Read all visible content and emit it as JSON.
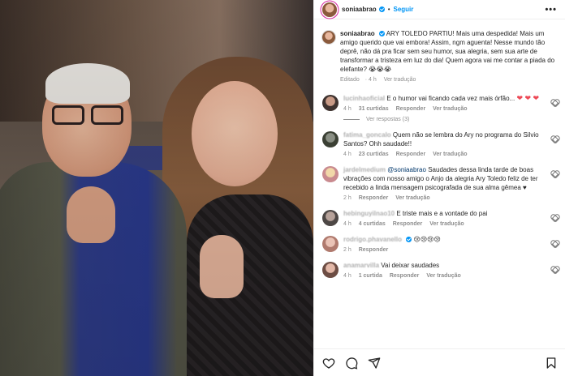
{
  "post": {
    "username": "soniaabrao",
    "follow_label": "Seguir",
    "more_label": "•••",
    "caption": "ARY TOLEDO PARTIU! Mais uma despedida! Mais um amigo querido que vai embora! Assim, ngm aguenta! Nesse mundo tão deprê, não dá pra ficar sem seu humor, sua alegria, sem sua arte de transformar a tristeza em luz do dia! Quem agora vai me contar a piada do elefante? 😭😭😭",
    "edited_label": "Editado",
    "time": "4 h",
    "translate_label": "Ver tradução"
  },
  "comments": [
    {
      "user": "lucinhaoficial",
      "text": "E o humor vai ficando cada vez mais órfão...",
      "hearts": "❤ ❤ ❤",
      "time": "4 h",
      "likes": "31 curtidas",
      "reply": "Responder",
      "translate": "Ver tradução",
      "view_replies": "Ver respostas (3)"
    },
    {
      "user": "fatima_goncalo",
      "text": "Quem não se lembra do Ary no programa do Silvio Santos? Ohh saudade!!",
      "time": "4 h",
      "likes": "23 curtidas",
      "reply": "Responder",
      "translate": "Ver tradução"
    },
    {
      "user": "jardelmedium",
      "mention": "@soniaabrao",
      "text": "Saudades dessa linda tarde de boas vibrações com nosso amigo o Anjo da alegria Ary Toledo feliz de ter recebido a linda mensagem psicografada de sua alma gêmea",
      "black_heart": "♥",
      "time": "2 h",
      "reply": "Responder",
      "translate": "Ver tradução"
    },
    {
      "user": "hebinguyilnao10",
      "text": "E triste mais e a vontade do pai",
      "time": "4 h",
      "likes": "4 curtidas",
      "reply": "Responder",
      "translate": "Ver tradução"
    },
    {
      "user": "rodrigo.phavanello",
      "text": "😢😢😢😢",
      "time": "2 h",
      "reply": "Responder"
    },
    {
      "user": "anamarvilla",
      "text": "Vai deixar saudades",
      "time": "4 h",
      "likes": "1 curtida",
      "reply": "Responder",
      "translate": "Ver tradução"
    }
  ],
  "actions": {
    "icons": [
      "heart-icon",
      "comment-icon",
      "share-icon",
      "bookmark-icon"
    ]
  },
  "colors": {
    "accent": "#0095f6",
    "muted": "#8e8e8e",
    "like_red": "#ed4956"
  }
}
